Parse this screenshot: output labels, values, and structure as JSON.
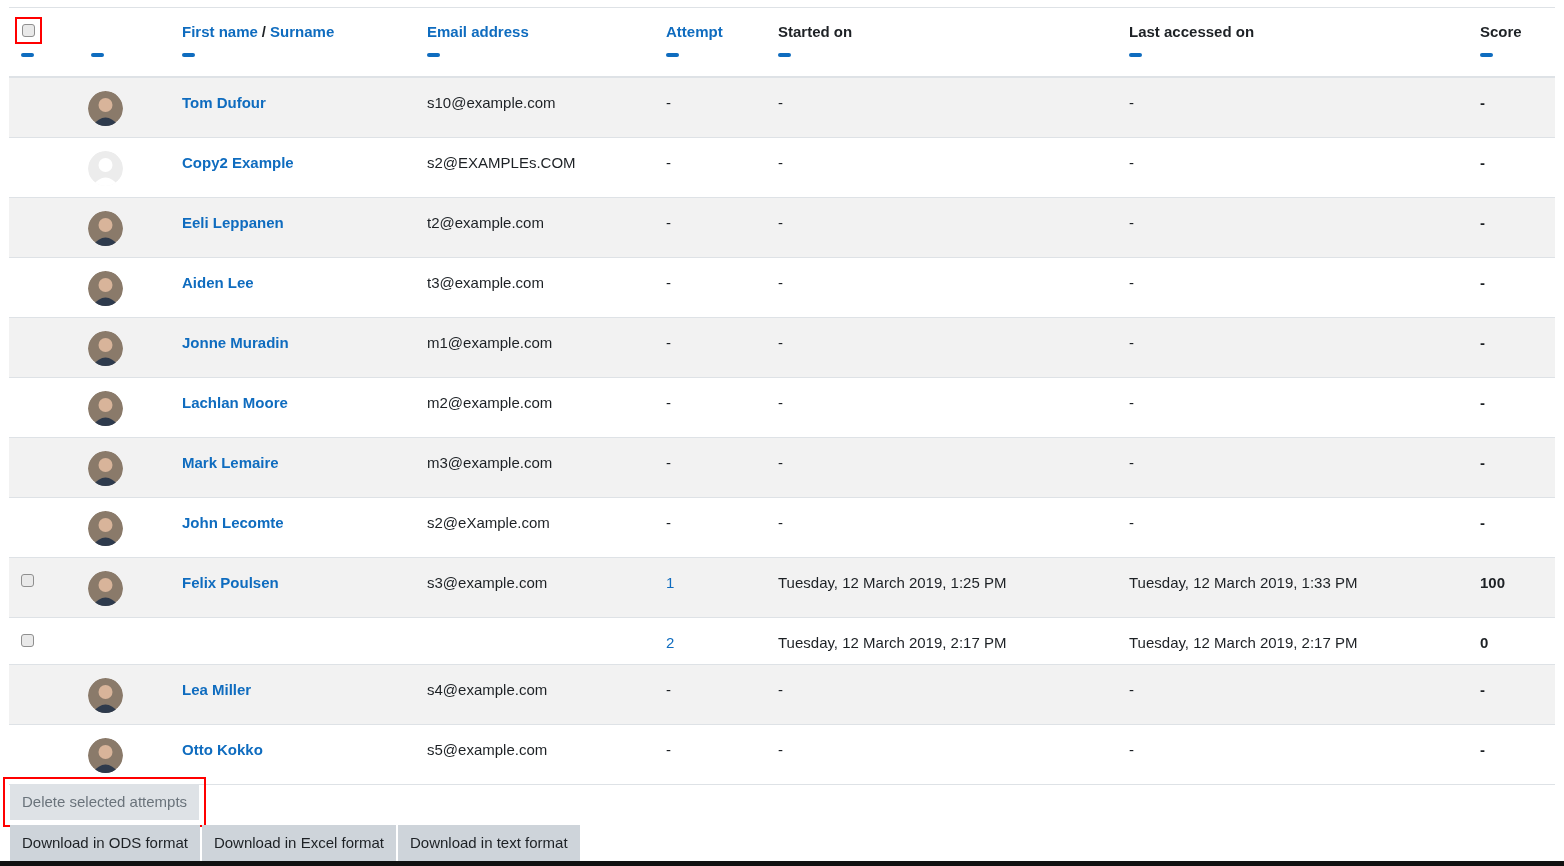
{
  "header": [
    {
      "kind": "checkbox",
      "checked": false,
      "highlighted": true
    },
    {
      "kind": "blank"
    },
    {
      "kind": "links",
      "labels": [
        "First name",
        "Surname"
      ],
      "separator": "/"
    },
    {
      "kind": "link",
      "label": "Email address"
    },
    {
      "kind": "link",
      "label": "Attempt"
    },
    {
      "kind": "text",
      "label": "Started on"
    },
    {
      "kind": "text",
      "label": "Last accessed on"
    },
    {
      "kind": "text",
      "label": "Score"
    }
  ],
  "rows": [
    {
      "kind": "user",
      "default_avatar": false,
      "name": "Tom Dufour",
      "email": "s10@example.com",
      "attempt": {
        "text": "-",
        "link": false
      },
      "started": "-",
      "last": "-",
      "score": "-"
    },
    {
      "kind": "user",
      "default_avatar": true,
      "name": "Copy2 Example",
      "email": "s2@EXAMPLEs.COM",
      "attempt": {
        "text": "-",
        "link": false
      },
      "started": "-",
      "last": "-",
      "score": "-"
    },
    {
      "kind": "user",
      "default_avatar": false,
      "name": "Eeli Leppanen",
      "email": "t2@example.com",
      "attempt": {
        "text": "-",
        "link": false
      },
      "started": "-",
      "last": "-",
      "score": "-"
    },
    {
      "kind": "user",
      "default_avatar": false,
      "name": "Aiden Lee",
      "email": "t3@example.com",
      "attempt": {
        "text": "-",
        "link": false
      },
      "started": "-",
      "last": "-",
      "score": "-"
    },
    {
      "kind": "user",
      "default_avatar": false,
      "name": "Jonne Muradin",
      "email": "m1@example.com",
      "attempt": {
        "text": "-",
        "link": false
      },
      "started": "-",
      "last": "-",
      "score": "-"
    },
    {
      "kind": "user",
      "default_avatar": false,
      "name": "Lachlan Moore",
      "email": "m2@example.com",
      "attempt": {
        "text": "-",
        "link": false
      },
      "started": "-",
      "last": "-",
      "score": "-"
    },
    {
      "kind": "user",
      "default_avatar": false,
      "name": "Mark Lemaire",
      "email": "m3@example.com",
      "attempt": {
        "text": "-",
        "link": false
      },
      "started": "-",
      "last": "-",
      "score": "-"
    },
    {
      "kind": "user",
      "default_avatar": false,
      "name": "John Lecomte",
      "email": "s2@eXample.com",
      "attempt": {
        "text": "-",
        "link": false
      },
      "started": "-",
      "last": "-",
      "score": "-"
    },
    {
      "kind": "user",
      "default_avatar": false,
      "checkbox": {
        "checked": false
      },
      "name": "Felix Poulsen",
      "email": "s3@example.com",
      "attempt": {
        "text": "1",
        "link": true
      },
      "started": "Tuesday, 12 March 2019, 1:25 PM",
      "last": "Tuesday, 12 March 2019, 1:33 PM",
      "score": "100"
    },
    {
      "kind": "attempt",
      "checkbox": {
        "checked": false
      },
      "attempt": {
        "text": "2",
        "link": true
      },
      "started": "Tuesday, 12 March 2019, 2:17 PM",
      "last": "Tuesday, 12 March 2019, 2:17 PM",
      "score": "0"
    },
    {
      "kind": "user",
      "default_avatar": false,
      "name": "Lea Miller",
      "email": "s4@example.com",
      "attempt": {
        "text": "-",
        "link": false
      },
      "started": "-",
      "last": "-",
      "score": "-"
    },
    {
      "kind": "user",
      "default_avatar": false,
      "name": "Otto Kokko",
      "email": "s5@example.com",
      "attempt": {
        "text": "-",
        "link": false
      },
      "started": "-",
      "last": "-",
      "score": "-"
    }
  ],
  "delete_button": {
    "label": "Delete selected attempts",
    "disabled": true,
    "highlighted": true
  },
  "download_buttons": [
    "Download in ODS format",
    "Download in Excel format",
    "Download in text format"
  ]
}
